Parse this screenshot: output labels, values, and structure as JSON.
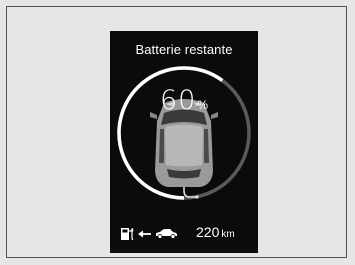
{
  "display": {
    "title": "Batterie restante",
    "battery_percent": 60,
    "battery_value": "60",
    "battery_unit": "%",
    "range_value": "220",
    "range_unit": "km"
  },
  "icons": {
    "gauge": "battery-arc-gauge",
    "car": "car-topview-icon",
    "plug_cable": "charging-cable-icon",
    "fuel_pump": "charging-station-icon",
    "arrow": "arrow-left-icon",
    "small_car": "car-side-icon"
  },
  "colors": {
    "screen_background": "#0b0b0b",
    "text": "#ffffff",
    "gauge_track": "#5a5a5a",
    "gauge_fill": "#ffffff"
  }
}
